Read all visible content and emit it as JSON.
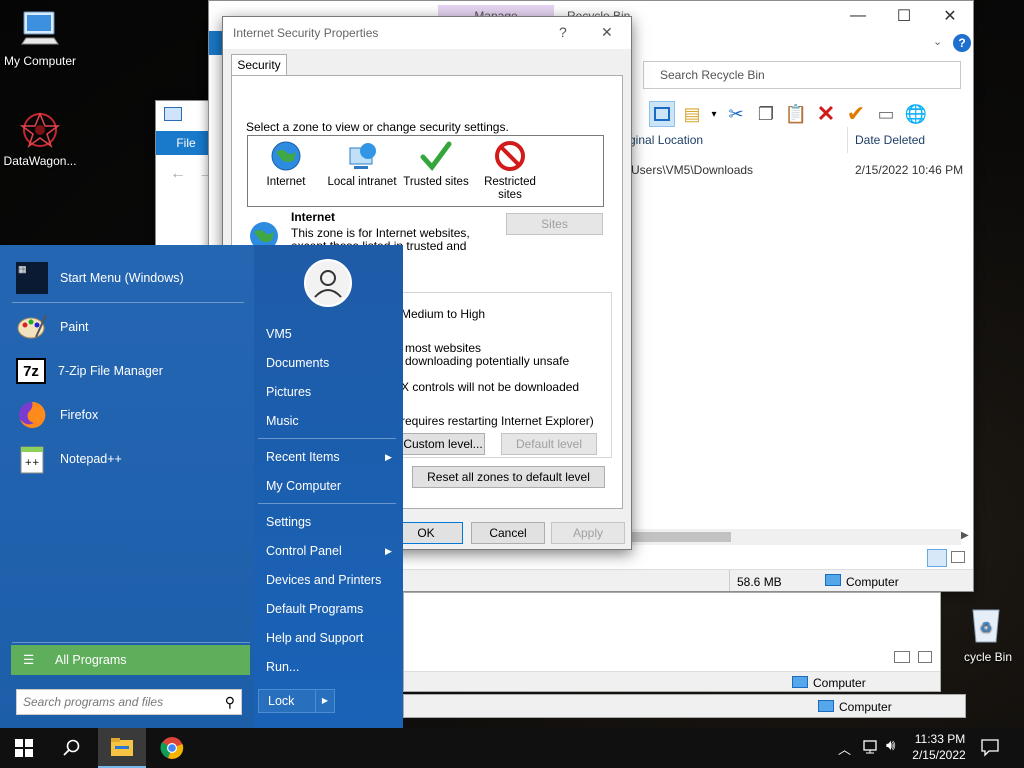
{
  "desktop": {
    "icons": [
      {
        "label": "My Computer",
        "icon": "computer-icon"
      },
      {
        "label": "DataWagon...",
        "icon": "datawagon-icon"
      },
      {
        "label": "cycle Bin",
        "icon": "recycle-bin-icon"
      }
    ]
  },
  "recycle_bin_window": {
    "tab_manage": "Manage",
    "title": "Recycle Bin",
    "search_placeholder": "Search Recycle Bin",
    "columns": {
      "original_location": "ginal Location",
      "date_deleted": "Date Deleted"
    },
    "rows": [
      {
        "location": "Users\\VM5\\Downloads",
        "date": "2/15/2022 10:46 PM"
      }
    ],
    "status_size": "58.6 MB",
    "status_computer": "Computer"
  },
  "background_windows": {
    "explorer_file_tab": "File",
    "status_computer_1": "Computer",
    "status_computer_2": "Computer"
  },
  "security_dialog": {
    "title": "Internet Security Properties",
    "help": "?",
    "close": "✕",
    "tab": "Security",
    "instruction": "Select a zone to view or change security settings.",
    "zones": [
      {
        "label": "Internet",
        "icon": "globe-icon"
      },
      {
        "label": "Local intranet",
        "icon": "intranet-icon"
      },
      {
        "label": "Trusted sites",
        "icon": "checkmark-icon"
      },
      {
        "label": "Restricted sites",
        "icon": "restricted-icon"
      }
    ],
    "zone_heading": "Internet",
    "zone_description": "This zone is for Internet websites, except those listed in trusted and restricted zones.",
    "sites_button": "Sites",
    "level_title": "Medium to High",
    "level_line1": "most websites",
    "level_line2": "downloading potentially unsafe",
    "level_line3": "X controls will not be downloaded",
    "level_line4": "requires restarting Internet Explorer)",
    "custom_level_button": "Custom level...",
    "default_level_button": "Default level",
    "reset_button": "Reset all zones to default level",
    "ok_button": "OK",
    "cancel_button": "Cancel",
    "apply_button": "Apply"
  },
  "start_menu": {
    "pinned": [
      {
        "label": "Start Menu (Windows)",
        "icon": "start-menu-icon"
      },
      {
        "label": "Paint",
        "icon": "paint-icon"
      },
      {
        "label": "7-Zip File Manager",
        "icon": "7zip-icon"
      },
      {
        "label": "Firefox",
        "icon": "firefox-icon"
      },
      {
        "label": "Notepad++",
        "icon": "notepadpp-icon"
      }
    ],
    "all_programs": "All Programs",
    "search_placeholder": "Search programs and files",
    "right": [
      {
        "label": "VM5"
      },
      {
        "label": "Documents"
      },
      {
        "label": "Pictures"
      },
      {
        "label": "Music"
      },
      {
        "label": "Recent Items"
      },
      {
        "label": "My Computer"
      },
      {
        "label": "Settings"
      },
      {
        "label": "Control Panel"
      },
      {
        "label": "Devices and Printers"
      },
      {
        "label": "Default Programs"
      },
      {
        "label": "Help and Support"
      },
      {
        "label": "Run..."
      }
    ],
    "lock": "Lock"
  },
  "taskbar": {
    "time": "11:33 PM",
    "date": "2/15/2022"
  }
}
